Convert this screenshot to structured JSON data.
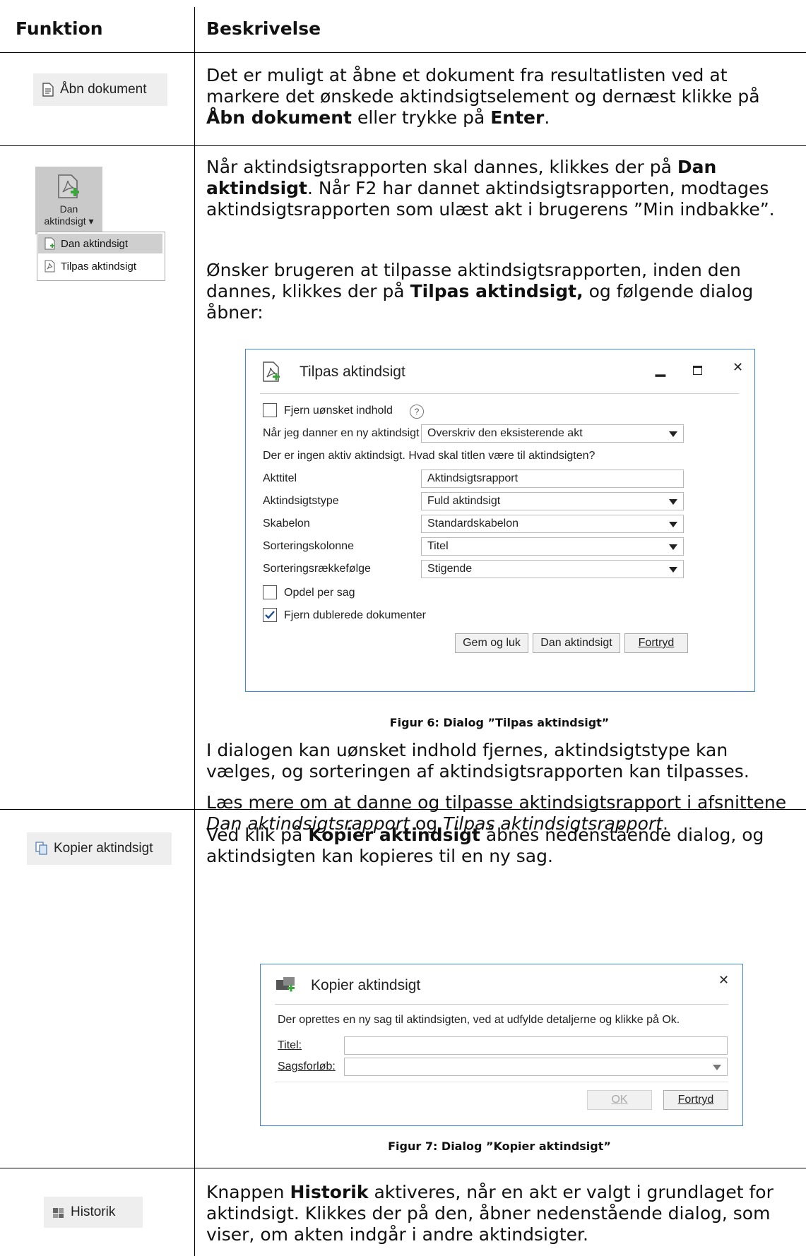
{
  "table": {
    "header_col1": "Funktion",
    "header_col2": "Beskrivelse"
  },
  "row1": {
    "button_label": "Åbn dokument",
    "text_a": "Det er muligt at åbne et dokument fra resultatlisten ved at markere det ønskede aktindsigtselement og dernæst klikke på ",
    "bold_1": "Åbn dokument",
    "text_b": " eller trykke på ",
    "bold_2": "Enter",
    "text_c": "."
  },
  "row2": {
    "button_line1": "Dan",
    "button_line2": "aktindsigt ▾",
    "menu_item1": "Dan aktindsigt",
    "menu_item2": "Tilpas aktindsigt",
    "p1_a": "Når aktindsigtsrapporten skal dannes, klikkes der på ",
    "p1_bold": "Dan aktindsigt",
    "p1_b": ". Når F2 har dannet aktindsigtsrapporten, modtages aktindsigtsrapporten som ulæst akt i brugerens ”Min indbakke”.",
    "p2_a": "Ønsker brugeren at tilpasse aktindsigtsrapporten, inden den dannes, klikkes der på ",
    "p2_bold": "Tilpas aktindsigt,",
    "p2_b": " og følgende dialog åbner:",
    "dialog": {
      "title": "Tilpas aktindsigt",
      "remove_unwanted": "Fjern uønsket indhold",
      "help_icon": "?",
      "new_label": "Når jeg danner en ny aktindsigt",
      "new_value": "Overskriv den eksisterende akt",
      "info": "Der er ingen aktiv aktindsigt. Hvad skal titlen være til aktindsigten?",
      "akttitel_label": "Akttitel",
      "akttitel_value": "Aktindsigtsrapport",
      "type_label": "Aktindsigtstype",
      "type_value": "Fuld aktindsigt",
      "template_label": "Skabelon",
      "template_value": "Standardskabelon",
      "sortcol_label": "Sorteringskolonne",
      "sortcol_value": "Titel",
      "sortorder_label": "Sorteringsrækkefølge",
      "sortorder_value": "Stigende",
      "split_label": "Opdel per sag",
      "dedupe_label": "Fjern dublerede dokumenter",
      "save_close": "Gem og luk",
      "create": "Dan aktindsigt",
      "cancel": "Fortryd"
    },
    "caption": "Figur 6: Dialog ”Tilpas aktindsigt”",
    "p3": "I dialogen kan uønsket indhold fjernes, aktindsigtstype kan vælges, og sorteringen af aktindsigtsrapporten kan tilpasses.",
    "p4_a": "Læs mere om at danne og tilpasse aktindsigtsrapport i afsnittene ",
    "p4_i1": "Dan aktindsigtsrapport",
    "p4_b": " og ",
    "p4_i2": "Tilpas aktindsigtsrapport",
    "p4_c": "."
  },
  "row3": {
    "button_label": "Kopier aktindsigt",
    "p_a": "Ved klik på ",
    "p_bold": "Kopier aktindsigt",
    "p_b": " åbnes nedenstående dialog, og aktindsigten kan kopieres til en ny sag.",
    "dialog": {
      "title": "Kopier aktindsigt",
      "info": "Der oprettes en ny sag til aktindsigten, ved at udfylde detaljerne og klikke på Ok.",
      "title_label": "Titel:",
      "case_label": "Sagsforløb:",
      "ok": "OK",
      "cancel": "Fortryd"
    },
    "caption": "Figur 7: Dialog ”Kopier aktindsigt”"
  },
  "row4": {
    "button_label": "Historik",
    "p_a": "Knappen ",
    "p_bold": "Historik",
    "p_b": " aktiveres, når en akt er valgt i grundlaget for aktindsigt. Klikkes der på den, åbner nedenstående dialog, som viser, om akten indgår i andre aktindsigter."
  },
  "colors": {
    "dialog_border": "#3b8ad9",
    "button_bg": "#eeeeee",
    "selected_bg": "#c9c9c9"
  }
}
